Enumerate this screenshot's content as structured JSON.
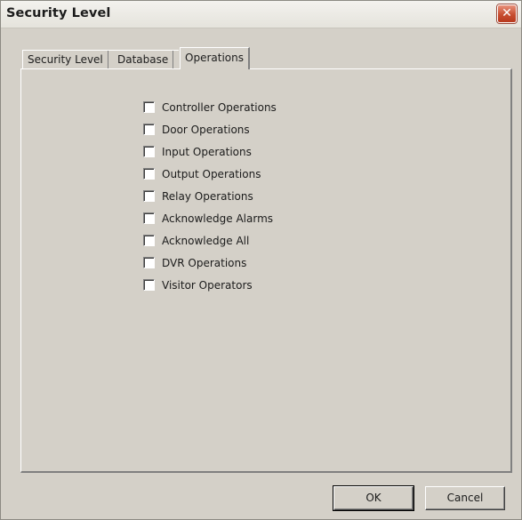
{
  "window": {
    "title": "Security Level",
    "close_glyph": "✕"
  },
  "tabs": [
    {
      "label": "Security Level",
      "active": false
    },
    {
      "label": "Database",
      "active": false
    },
    {
      "label": "Operations",
      "active": true
    }
  ],
  "operations": [
    {
      "label": "Controller Operations",
      "checked": false
    },
    {
      "label": "Door Operations",
      "checked": false
    },
    {
      "label": "Input Operations",
      "checked": false
    },
    {
      "label": "Output Operations",
      "checked": false
    },
    {
      "label": "Relay Operations",
      "checked": false
    },
    {
      "label": "Acknowledge Alarms",
      "checked": false
    },
    {
      "label": "Acknowledge All",
      "checked": false
    },
    {
      "label": "DVR Operations",
      "checked": false
    },
    {
      "label": "Visitor Operators",
      "checked": false
    }
  ],
  "buttons": {
    "ok_label": "OK",
    "cancel_label": "Cancel"
  }
}
